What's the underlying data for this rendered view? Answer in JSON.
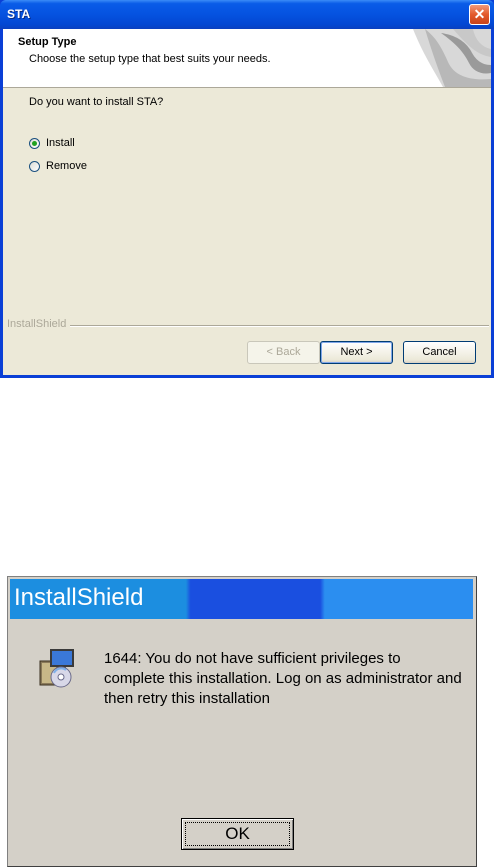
{
  "setup_window": {
    "title": "STA",
    "close_glyph": "✕",
    "header": {
      "title": "Setup Type",
      "subtitle": "Choose the setup type that best suits your needs."
    },
    "question": "Do you want to install STA?",
    "options": [
      {
        "label": "Install",
        "selected": true
      },
      {
        "label": "Remove",
        "selected": false
      }
    ],
    "brand_label": "InstallShield",
    "buttons": {
      "back": "< Back",
      "next": "Next >",
      "cancel": "Cancel"
    }
  },
  "error_dialog": {
    "title": "InstallShield",
    "message": "1644: You do not have sufficient privileges to complete this installation. Log on as administrator and then retry this installation",
    "ok_label": "OK",
    "icon": "installer-package-icon"
  },
  "colors": {
    "xp_titlebar": "#0552e0",
    "dialog_face": "#ece9d8",
    "classic_face": "#d4d0c8",
    "close_button": "#e35a2c"
  }
}
